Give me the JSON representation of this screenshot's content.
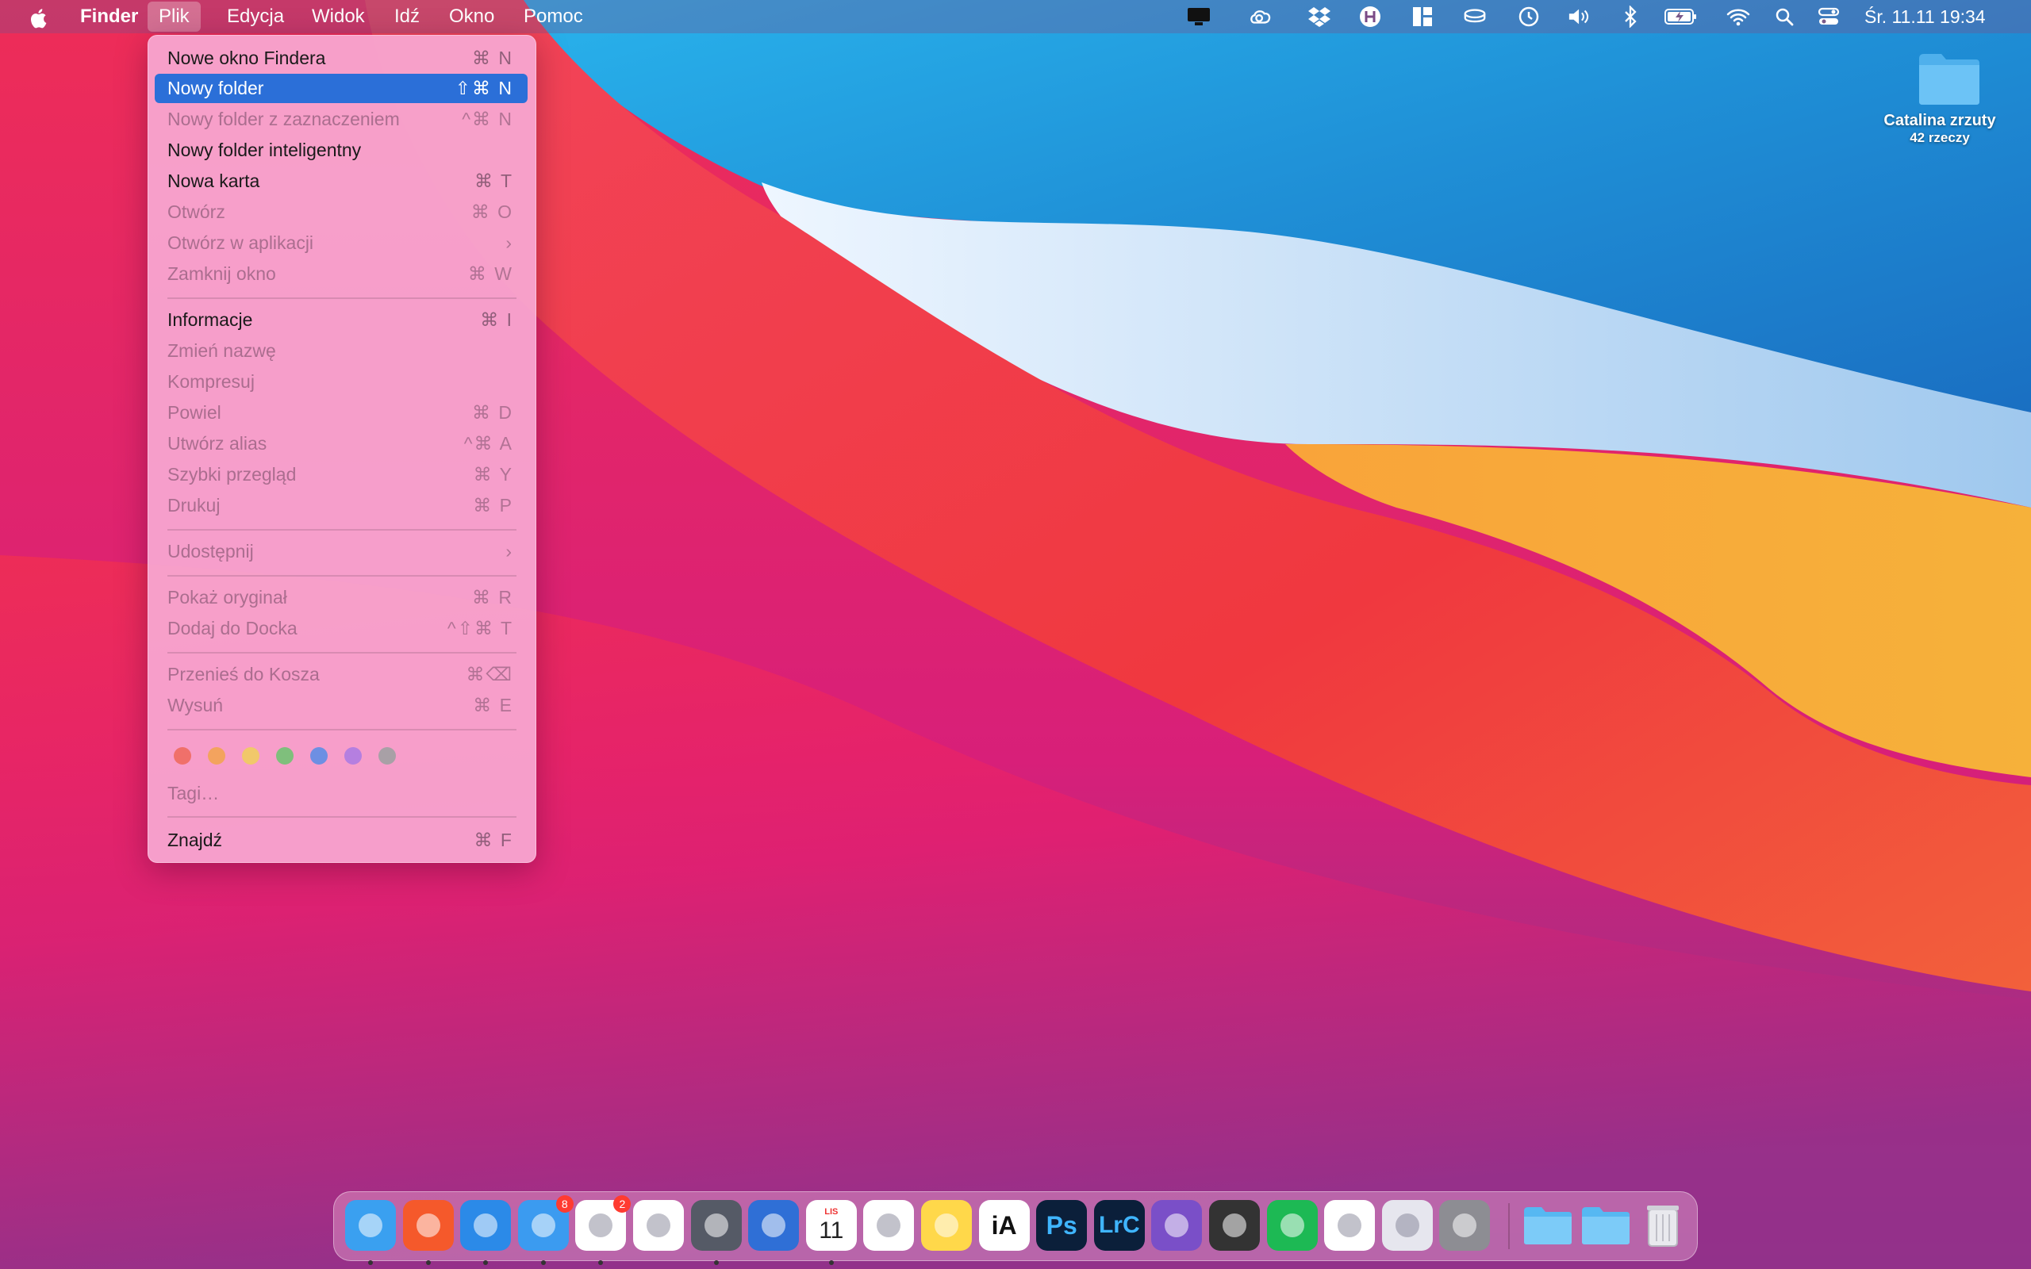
{
  "menubar": {
    "apple_icon": "apple-icon",
    "app_name": "Finder",
    "menus": [
      "Plik",
      "Edycja",
      "Widok",
      "Idź",
      "Okno",
      "Pomoc"
    ],
    "active_menu": "Plik",
    "clock": "Śr. 11.11  19:34",
    "tray_icons": [
      "display-icon",
      "creative-cloud-icon",
      "dropbox-icon",
      "app-h-icon",
      "window-layout-icon",
      "cup-icon",
      "time-machine-icon",
      "volume-icon",
      "bluetooth-icon",
      "battery-icon",
      "wifi-icon",
      "search-icon",
      "control-center-icon"
    ]
  },
  "file_menu": {
    "items": [
      {
        "label": "Nowe okno Findera",
        "shortcut": "⌘ N",
        "enabled": true
      },
      {
        "label": "Nowy folder",
        "shortcut": "⇧⌘ N",
        "enabled": true,
        "highlighted": true
      },
      {
        "label": "Nowy folder z zaznaczeniem",
        "shortcut": "^⌘ N",
        "enabled": false
      },
      {
        "label": "Nowy folder inteligentny",
        "shortcut": "",
        "enabled": true
      },
      {
        "label": "Nowa karta",
        "shortcut": "⌘ T",
        "enabled": true
      },
      {
        "label": "Otwórz",
        "shortcut": "⌘ O",
        "enabled": false
      },
      {
        "label": "Otwórz w aplikacji",
        "shortcut": "›",
        "enabled": false
      },
      {
        "label": "Zamknij okno",
        "shortcut": "⌘ W",
        "enabled": false
      },
      {
        "label": "Informacje",
        "shortcut": "⌘ I",
        "enabled": true
      },
      {
        "label": "Zmień nazwę",
        "shortcut": "",
        "enabled": false
      },
      {
        "label": "Kompresuj",
        "shortcut": "",
        "enabled": false
      },
      {
        "label": "Powiel",
        "shortcut": "⌘ D",
        "enabled": false
      },
      {
        "label": "Utwórz alias",
        "shortcut": "^⌘ A",
        "enabled": false
      },
      {
        "label": "Szybki przegląd",
        "shortcut": "⌘ Y",
        "enabled": false
      },
      {
        "label": "Drukuj",
        "shortcut": "⌘ P",
        "enabled": false
      },
      {
        "label": "Udostępnij",
        "shortcut": "›",
        "enabled": false
      },
      {
        "label": "Pokaż oryginał",
        "shortcut": "⌘ R",
        "enabled": false
      },
      {
        "label": "Dodaj do Docka",
        "shortcut": "^⇧⌘ T",
        "enabled": false
      },
      {
        "label": "Przenieś do Kosza",
        "shortcut": "⌘⌫",
        "enabled": false
      },
      {
        "label": "Wysuń",
        "shortcut": "⌘ E",
        "enabled": false
      },
      {
        "label": "Tagi…",
        "shortcut": "",
        "enabled": false
      },
      {
        "label": "Znajdź",
        "shortcut": "⌘ F",
        "enabled": true
      }
    ],
    "tag_colors": [
      "#f0706a",
      "#f3a35e",
      "#f1c86a",
      "#7fbf7c",
      "#6d8fe3",
      "#b57fe0",
      "#a8a0a6"
    ]
  },
  "desktop": {
    "folder_name": "Catalina zrzuty",
    "folder_count": "42 rzeczy"
  },
  "dock": {
    "apps": [
      {
        "name": "finder-icon",
        "text": "",
        "color": "#3aa0f0",
        "running": true
      },
      {
        "name": "brave-icon",
        "text": "",
        "color": "#f5592b",
        "running": true
      },
      {
        "name": "safari-icon",
        "text": "",
        "color": "#2b8ae8",
        "running": true
      },
      {
        "name": "mail-icon",
        "text": "",
        "color": "#3b9bf0",
        "running": true,
        "badge": "8"
      },
      {
        "name": "slack-icon",
        "text": "",
        "color": "#ffffff",
        "running": true,
        "badge": "2"
      },
      {
        "name": "photos-icon",
        "text": "",
        "color": "#ffffff",
        "running": false
      },
      {
        "name": "vectorize-icon",
        "text": "",
        "color": "#555a66",
        "running": true
      },
      {
        "name": "tasks-icon",
        "text": "",
        "color": "#2f6fd6",
        "running": false
      },
      {
        "name": "calendar-icon",
        "text": "11",
        "month": "LIS",
        "color": "#ffffff",
        "running": true
      },
      {
        "name": "reminders-icon",
        "text": "",
        "color": "#ffffff",
        "running": false
      },
      {
        "name": "notes-icon",
        "text": "",
        "color": "#ffd84a",
        "running": false
      },
      {
        "name": "ia-writer-icon",
        "text": "iA",
        "color": "#ffffff",
        "running": false
      },
      {
        "name": "photoshop-icon",
        "text": "Ps",
        "color": "#0b1f3a",
        "running": false
      },
      {
        "name": "lightroom-classic-icon",
        "text": "LrC",
        "color": "#0b1f3a",
        "running": false
      },
      {
        "name": "affinity-photo-icon",
        "text": "",
        "color": "#7a4fc8",
        "running": false
      },
      {
        "name": "final-cut-icon",
        "text": "",
        "color": "#333333",
        "running": false
      },
      {
        "name": "spotify-icon",
        "text": "",
        "color": "#1db954",
        "running": false
      },
      {
        "name": "messenger-icon",
        "text": "",
        "color": "#ffffff",
        "running": false
      },
      {
        "name": "launchpad-icon",
        "text": "",
        "color": "#e6e6ee",
        "running": false
      },
      {
        "name": "system-preferences-icon",
        "text": "",
        "color": "#8d8d93",
        "running": false
      }
    ],
    "stacks": [
      "downloads-stack-icon",
      "documents-stack-icon",
      "trash-icon"
    ]
  }
}
